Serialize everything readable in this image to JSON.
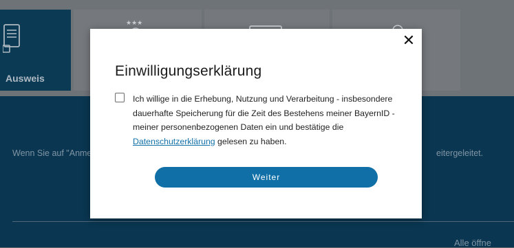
{
  "background": {
    "tabs": [
      {
        "label": "Ausweis",
        "icon": "document-card-icon",
        "active": true
      },
      {
        "label": "",
        "icon": "eu-stars-icon",
        "active": false
      },
      {
        "label": "",
        "icon": "id-card-icon",
        "active": false
      },
      {
        "label": "",
        "icon": "user-icon",
        "active": false
      }
    ],
    "info_left": "Wenn Sie auf \"Anme",
    "info_right": "eitergeleitet.",
    "expand_all": "Alle öffne"
  },
  "modal": {
    "title": "Einwilligungserklärung",
    "close_label": "✕",
    "consent_text": "Ich willige in die Erhebung, Nutzung und Verarbeitung - insbesondere dauerhafte Speicherung für die Zeit des Bestehens meiner BayernID - meiner personenbezogenen Daten ein und bestätige die ",
    "privacy_link": "Datenschutzerklärung",
    "consent_suffix": " gelesen zu haben.",
    "checkbox_checked": false,
    "continue_button": "Weiter"
  },
  "colors": {
    "overlay": "#666b70",
    "band": "#0a3651",
    "primary": "#0f6fa6",
    "link": "#1170a8"
  }
}
